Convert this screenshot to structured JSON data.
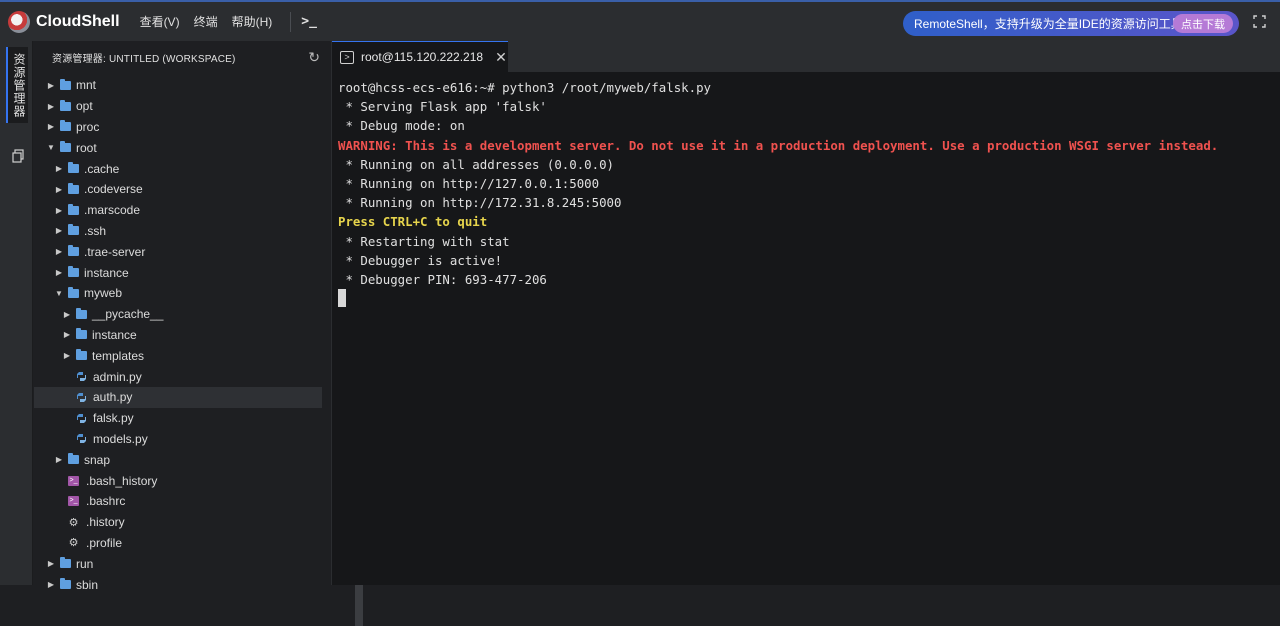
{
  "app": {
    "title": "CloudShell",
    "menu": [
      "查看(V)",
      "终端",
      "帮助(H)"
    ],
    "terminal_shortcut_icon": ">_"
  },
  "promo": {
    "text": "RemoteShell，支持升级为全量IDE的资源访问工具",
    "button": "点击下载"
  },
  "activity": {
    "explorer_label": "资源管理器"
  },
  "explorer": {
    "title": "资源管理器: UNTITLED (WORKSPACE)",
    "tree": [
      {
        "label": "mnt",
        "type": "folder",
        "depth": 0,
        "expanded": false
      },
      {
        "label": "opt",
        "type": "folder",
        "depth": 0,
        "expanded": false
      },
      {
        "label": "proc",
        "type": "folder",
        "depth": 0,
        "expanded": false
      },
      {
        "label": "root",
        "type": "folder",
        "depth": 0,
        "expanded": true
      },
      {
        "label": ".cache",
        "type": "folder",
        "depth": 1,
        "expanded": false
      },
      {
        "label": ".codeverse",
        "type": "folder",
        "depth": 1,
        "expanded": false
      },
      {
        "label": ".marscode",
        "type": "folder",
        "depth": 1,
        "expanded": false
      },
      {
        "label": ".ssh",
        "type": "folder",
        "depth": 1,
        "expanded": false
      },
      {
        "label": ".trae-server",
        "type": "folder",
        "depth": 1,
        "expanded": false
      },
      {
        "label": "instance",
        "type": "folder",
        "depth": 1,
        "expanded": false
      },
      {
        "label": "myweb",
        "type": "folder",
        "depth": 1,
        "expanded": true
      },
      {
        "label": "__pycache__",
        "type": "folder",
        "depth": 2,
        "expanded": false
      },
      {
        "label": "instance",
        "type": "folder",
        "depth": 2,
        "expanded": false
      },
      {
        "label": "templates",
        "type": "folder",
        "depth": 2,
        "expanded": false
      },
      {
        "label": "admin.py",
        "type": "py",
        "depth": 2
      },
      {
        "label": "auth.py",
        "type": "py",
        "depth": 2,
        "selected": true
      },
      {
        "label": "falsk.py",
        "type": "py",
        "depth": 2
      },
      {
        "label": "models.py",
        "type": "py",
        "depth": 2
      },
      {
        "label": "snap",
        "type": "folder",
        "depth": 1,
        "expanded": false
      },
      {
        "label": ".bash_history",
        "type": "sh",
        "depth": 1
      },
      {
        "label": ".bashrc",
        "type": "sh",
        "depth": 1
      },
      {
        "label": ".history",
        "type": "gear",
        "depth": 1
      },
      {
        "label": ".profile",
        "type": "gear",
        "depth": 1
      },
      {
        "label": "run",
        "type": "folder",
        "depth": 0,
        "expanded": false
      },
      {
        "label": "sbin",
        "type": "folder",
        "depth": 0,
        "expanded": false
      }
    ]
  },
  "terminal": {
    "tab_label": "root@115.120.222.218",
    "lines": [
      {
        "text": "root@hcss-ecs-e616:~# python3 /root/myweb/falsk.py",
        "style": "normal"
      },
      {
        "text": " * Serving Flask app 'falsk'",
        "style": "normal"
      },
      {
        "text": " * Debug mode: on",
        "style": "normal"
      },
      {
        "text": "WARNING: This is a development server. Do not use it in a production deployment. Use a production WSGI server instead.",
        "style": "warn"
      },
      {
        "text": " * Running on all addresses (0.0.0.0)",
        "style": "normal"
      },
      {
        "text": " * Running on http://127.0.0.1:5000",
        "style": "normal"
      },
      {
        "text": " * Running on http://172.31.8.245:5000",
        "style": "normal"
      },
      {
        "text": "Press CTRL+C to quit",
        "style": "yellow"
      },
      {
        "text": " * Restarting with stat",
        "style": "normal"
      },
      {
        "text": " * Debugger is active!",
        "style": "normal"
      },
      {
        "text": " * Debugger PIN: 693-477-206",
        "style": "normal"
      }
    ]
  },
  "colors": {
    "accent": "#3574f0",
    "warning": "#f0524f",
    "highlight": "#e6d44c",
    "folder": "#5f9fe0"
  }
}
